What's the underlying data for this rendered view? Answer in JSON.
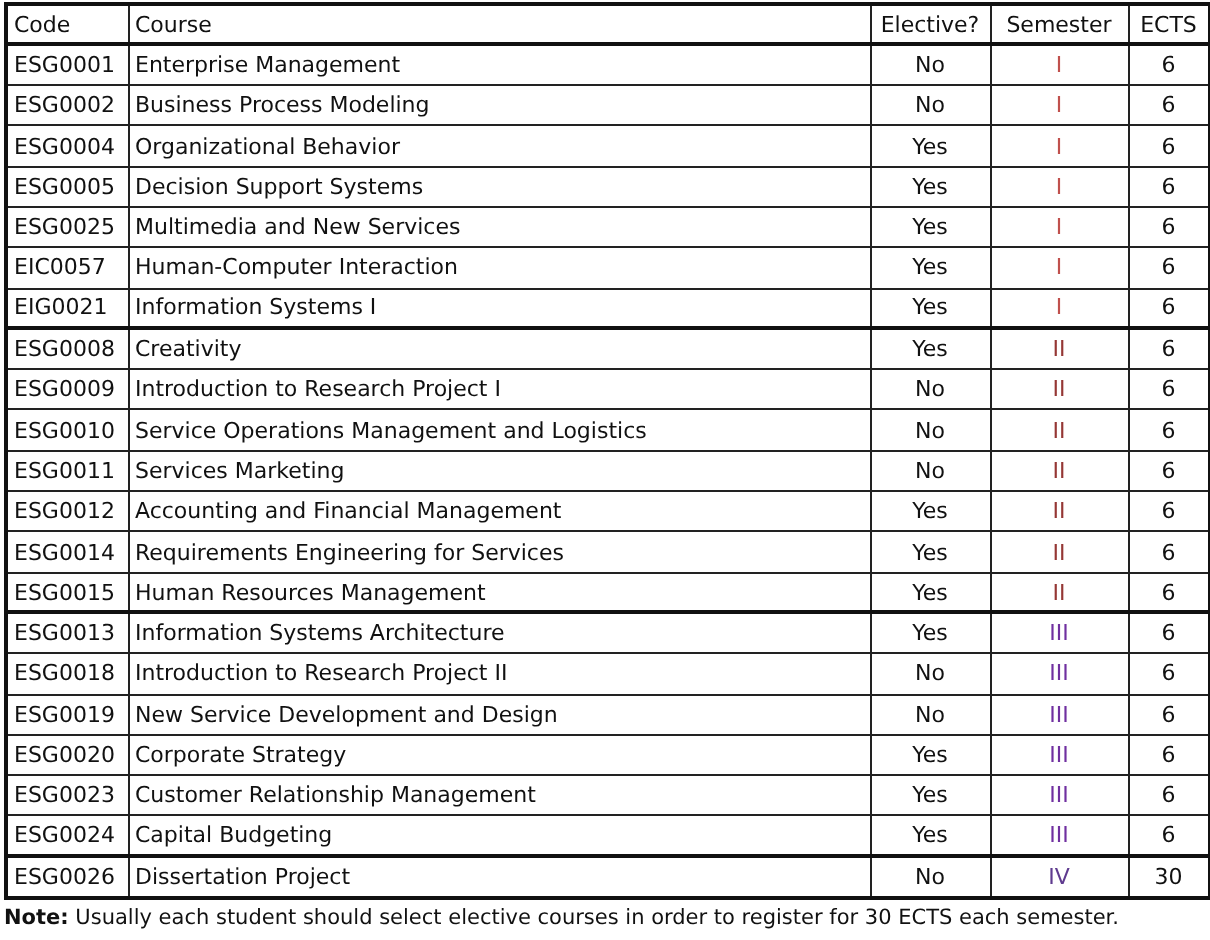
{
  "table": {
    "columns": [
      "Code",
      "Course",
      "Elective?",
      "Semester",
      "ECTS"
    ],
    "groups": [
      {
        "rows": [
          {
            "code": "ESG0001",
            "course": "Enterprise Management",
            "elective": "No",
            "semester": "I",
            "color": "#c0504d",
            "ects": "6"
          },
          {
            "code": "ESG0002",
            "course": "Business Process Modeling",
            "elective": "No",
            "semester": "I",
            "color": "#c0504d",
            "ects": "6"
          },
          {
            "code": "ESG0004",
            "course": "Organizational Behavior",
            "elective": "Yes",
            "semester": "I",
            "color": "#c0504d",
            "ects": "6"
          },
          {
            "code": "ESG0005",
            "course": "Decision Support Systems",
            "elective": "Yes",
            "semester": "I",
            "color": "#c0504d",
            "ects": "6"
          },
          {
            "code": "ESG0025",
            "course": "Multimedia and New Services",
            "elective": "Yes",
            "semester": "I",
            "color": "#c0504d",
            "ects": "6"
          },
          {
            "code": "EIC0057",
            "course": "Human-Computer Interaction",
            "elective": "Yes",
            "semester": "I",
            "color": "#c0504d",
            "ects": "6"
          },
          {
            "code": "EIG0021",
            "course": "Information Systems I",
            "elective": "Yes",
            "semester": "I",
            "color": "#c0504d",
            "ects": "6"
          }
        ]
      },
      {
        "rows": [
          {
            "code": "ESG0008",
            "course": "Creativity",
            "elective": "Yes",
            "semester": "II",
            "color": "#953735",
            "ects": "6"
          },
          {
            "code": "ESG0009",
            "course": "Introduction to Research Project I",
            "elective": "No",
            "semester": "II",
            "color": "#953735",
            "ects": "6"
          },
          {
            "code": "ESG0010",
            "course": "Service Operations Management and Logistics",
            "elective": "No",
            "semester": "II",
            "color": "#953735",
            "ects": "6"
          },
          {
            "code": "ESG0011",
            "course": "Services Marketing",
            "elective": "No",
            "semester": "II",
            "color": "#953735",
            "ects": "6"
          },
          {
            "code": "ESG0012",
            "course": "Accounting and Financial Management",
            "elective": "Yes",
            "semester": "II",
            "color": "#953735",
            "ects": "6"
          },
          {
            "code": "ESG0014",
            "course": "Requirements Engineering for Services",
            "elective": "Yes",
            "semester": "II",
            "color": "#953735",
            "ects": "6"
          },
          {
            "code": "ESG0015",
            "course": "Human Resources Management",
            "elective": "Yes",
            "semester": "II",
            "color": "#953735",
            "ects": "6"
          }
        ]
      },
      {
        "rows": [
          {
            "code": "ESG0013",
            "course": "Information Systems Architecture",
            "elective": "Yes",
            "semester": "III",
            "color": "#7030a0",
            "ects": "6"
          },
          {
            "code": "ESG0018",
            "course": "Introduction to Research Project II",
            "elective": "No",
            "semester": "III",
            "color": "#7030a0",
            "ects": "6"
          },
          {
            "code": "ESG0019",
            "course": "New Service Development and Design",
            "elective": "No",
            "semester": "III",
            "color": "#7030a0",
            "ects": "6"
          },
          {
            "code": "ESG0020",
            "course": "Corporate Strategy",
            "elective": "Yes",
            "semester": "III",
            "color": "#7030a0",
            "ects": "6"
          },
          {
            "code": "ESG0023",
            "course": "Customer Relationship Management",
            "elective": "Yes",
            "semester": "III",
            "color": "#7030a0",
            "ects": "6"
          },
          {
            "code": "ESG0024",
            "course": "Capital Budgeting",
            "elective": "Yes",
            "semester": "III",
            "color": "#7030a0",
            "ects": "6"
          }
        ]
      },
      {
        "rows": [
          {
            "code": "ESG0026",
            "course": "Dissertation Project",
            "elective": "No",
            "semester": "IV",
            "color": "#5f3b8f",
            "ects": "30"
          }
        ]
      }
    ]
  },
  "note": "**Note:** Usually each student should select elective courses in order to register for 30 ECTS each semester."
}
